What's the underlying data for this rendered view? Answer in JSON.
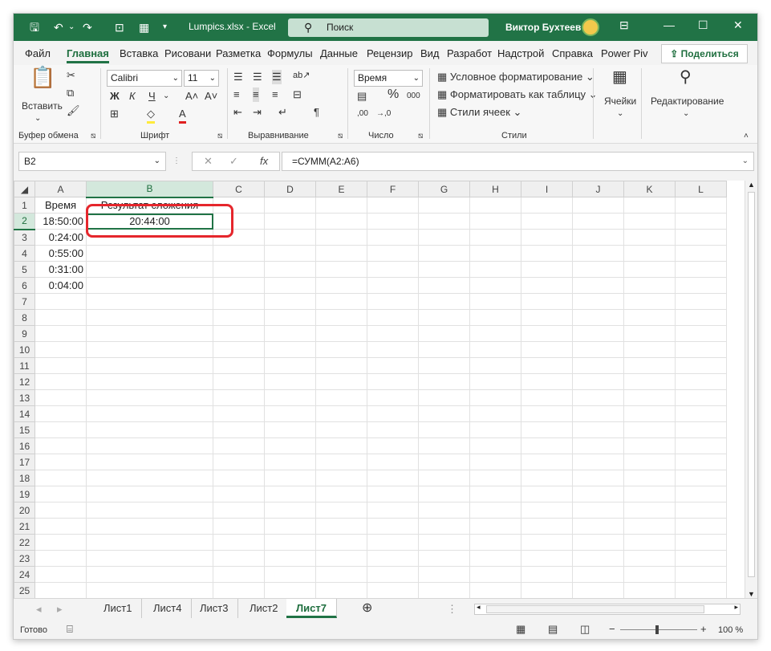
{
  "titlebar": {
    "doc_title": "Lumpics.xlsx  -  Excel",
    "search_placeholder": "Поиск",
    "user": "Виктор Бухтеев"
  },
  "tabs": [
    "Файл",
    "Главная",
    "Вставка",
    "Рисовани",
    "Разметка",
    "Формулы",
    "Данные",
    "Рецензир",
    "Вид",
    "Разработ",
    "Надстрой",
    "Справка",
    "Power Piv"
  ],
  "share_label": "Поделиться",
  "ribbon": {
    "paste_label": "Вставить",
    "clipboard_group": "Буфер обмена",
    "font_name": "Calibri",
    "font_size": "11",
    "bold": "Ж",
    "italic": "К",
    "underline": "Ч",
    "font_group": "Шрифт",
    "align_group": "Выравнивание",
    "number_format": "Время",
    "number_group": "Число",
    "cond_format": "Условное форматирование",
    "format_table": "Форматировать как таблицу",
    "cell_styles": "Стили ячеек",
    "styles_group": "Стили",
    "cells_label": "Ячейки",
    "editing_label": "Редактирование"
  },
  "formula_bar": {
    "cell_ref": "B2",
    "formula": "=СУММ(A2:A6)",
    "fx": "fx"
  },
  "columns": [
    "A",
    "B",
    "C",
    "D",
    "E",
    "F",
    "G",
    "H",
    "I",
    "J",
    "K",
    "L"
  ],
  "rows": [
    {
      "n": "1",
      "a": "Время",
      "b": "Результат сложения"
    },
    {
      "n": "2",
      "a": "18:50:00",
      "b": "20:44:00"
    },
    {
      "n": "3",
      "a": "0:24:00",
      "b": ""
    },
    {
      "n": "4",
      "a": "0:55:00",
      "b": ""
    },
    {
      "n": "5",
      "a": "0:31:00",
      "b": ""
    },
    {
      "n": "6",
      "a": "0:04:00",
      "b": ""
    },
    {
      "n": "7",
      "a": "",
      "b": ""
    },
    {
      "n": "8",
      "a": "",
      "b": ""
    },
    {
      "n": "9",
      "a": "",
      "b": ""
    },
    {
      "n": "10",
      "a": "",
      "b": ""
    },
    {
      "n": "11",
      "a": "",
      "b": ""
    },
    {
      "n": "12",
      "a": "",
      "b": ""
    },
    {
      "n": "13",
      "a": "",
      "b": ""
    },
    {
      "n": "14",
      "a": "",
      "b": ""
    },
    {
      "n": "15",
      "a": "",
      "b": ""
    },
    {
      "n": "16",
      "a": "",
      "b": ""
    },
    {
      "n": "17",
      "a": "",
      "b": ""
    },
    {
      "n": "18",
      "a": "",
      "b": ""
    },
    {
      "n": "19",
      "a": "",
      "b": ""
    },
    {
      "n": "20",
      "a": "",
      "b": ""
    },
    {
      "n": "21",
      "a": "",
      "b": ""
    },
    {
      "n": "22",
      "a": "",
      "b": ""
    },
    {
      "n": "23",
      "a": "",
      "b": ""
    },
    {
      "n": "24",
      "a": "",
      "b": ""
    },
    {
      "n": "25",
      "a": "",
      "b": ""
    }
  ],
  "sheets": [
    "Лист1",
    "Лист4",
    "Лист3",
    "Лист2",
    "Лист7"
  ],
  "active_sheet": "Лист7",
  "status": {
    "ready": "Готово",
    "zoom": "100 %"
  },
  "colors": {
    "accent": "#217346",
    "highlight": "#e5262c"
  }
}
